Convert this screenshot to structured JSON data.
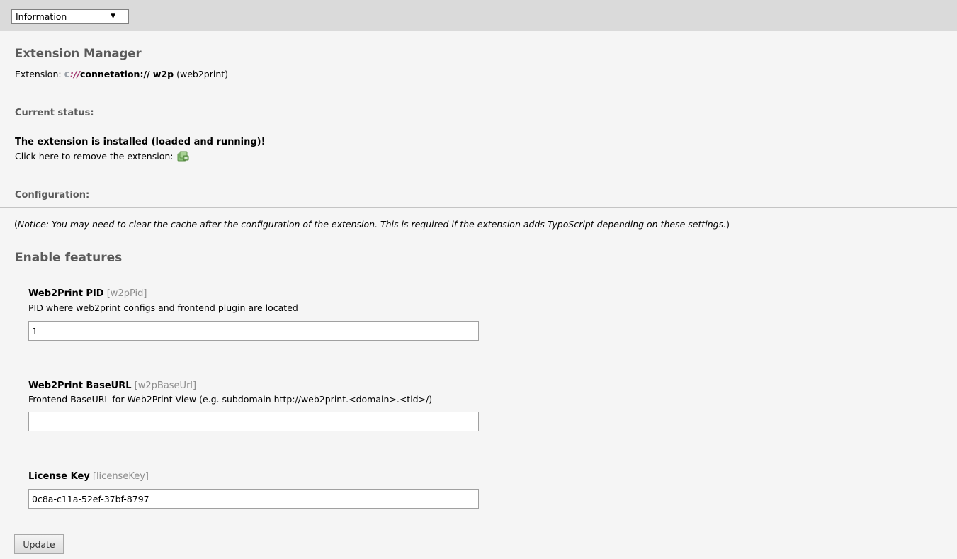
{
  "toolbar": {
    "menu_selected": "Information",
    "menu_arrow": "▼"
  },
  "header": {
    "title": "Extension Manager",
    "extension_prefix": "Extension:",
    "logo_c": "c",
    "logo_slash": "://",
    "extension_name": "connetation:// w2p",
    "extension_key": "(web2print)"
  },
  "status": {
    "title": "Current status:",
    "installed_message": "The extension is installed (loaded and running)!",
    "remove_text": "Click here to remove the extension:",
    "remove_icon": "remove-extension-icon"
  },
  "configuration": {
    "title": "Configuration:",
    "notice_open": "(",
    "notice_text": "Notice: You may need to clear the cache after the configuration of the extension. This is required if the extension adds TypoScript depending on these settings.",
    "notice_close": ")"
  },
  "features": {
    "title": "Enable features",
    "fields": [
      {
        "label": "Web2Print PID",
        "key": "[w2pPid]",
        "description": "PID where web2print configs and frontend plugin are located",
        "value": "1"
      },
      {
        "label": "Web2Print BaseURL",
        "key": "[w2pBaseUrl]",
        "description": "Frontend BaseURL for Web2Print View (e.g. subdomain http://web2print.<domain>.<tld>/)",
        "value": ""
      },
      {
        "label": "License Key",
        "key": "[licenseKey]",
        "description": "",
        "value": "0c8a-c11a-52ef-37bf-8797"
      }
    ]
  },
  "actions": {
    "update_label": "Update"
  },
  "colors": {
    "topbar_bg": "#dadada",
    "page_bg": "#f5f5f5",
    "heading_gray": "#5a5a5a",
    "key_gray": "#8c8c8c",
    "logo_accent": "#a0306a",
    "icon_green": "#7fb86a"
  }
}
